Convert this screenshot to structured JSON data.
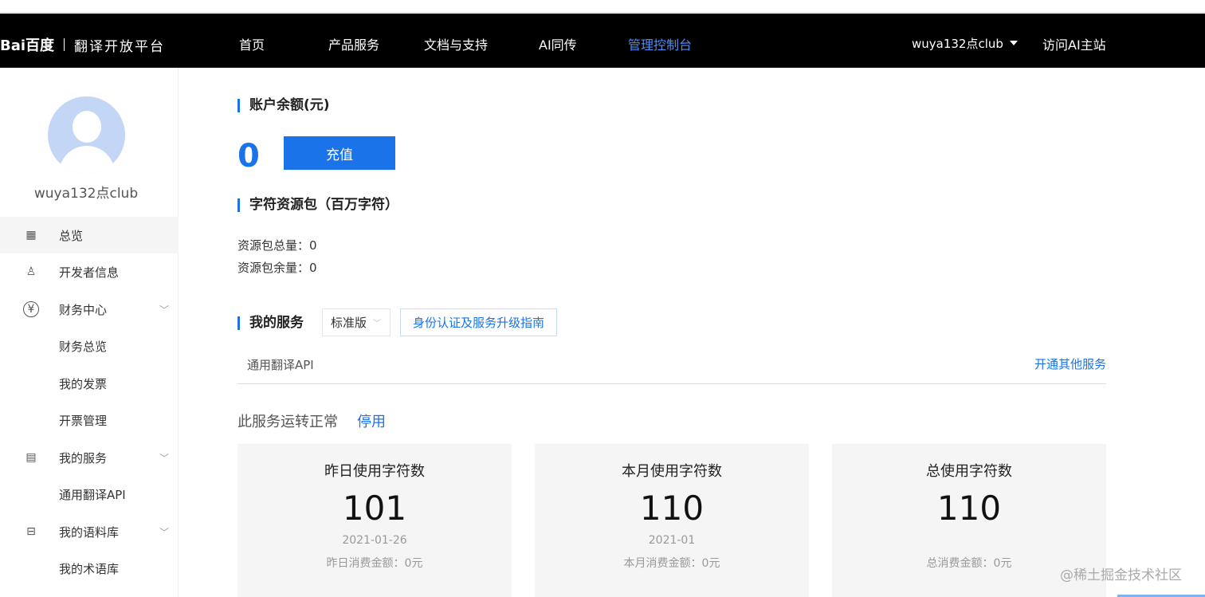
{
  "header": {
    "logo": "Bai百度",
    "subtitle": "翻译开放平台",
    "nav": [
      "首页",
      "产品服务",
      "文档与支持",
      "AI同传",
      "管理控制台"
    ],
    "user": "wuya132点club",
    "visit": "访问AI主站"
  },
  "sidebar": {
    "username": "wuya132点club",
    "items": [
      {
        "label": "总览",
        "icon": "grid-icon"
      },
      {
        "label": "开发者信息",
        "icon": "user-icon"
      },
      {
        "label": "财务中心",
        "icon": "yen-icon"
      },
      {
        "label": "财务总览"
      },
      {
        "label": "我的发票"
      },
      {
        "label": "开票管理"
      },
      {
        "label": "我的服务",
        "icon": "document-icon"
      },
      {
        "label": "通用翻译API"
      },
      {
        "label": "我的语料库",
        "icon": "inbox-icon"
      },
      {
        "label": "我的术语库"
      }
    ]
  },
  "main": {
    "balance_title": "账户余额(元)",
    "balance": "0",
    "recharge": "充值",
    "pack_title": "字符资源包（百万字符）",
    "pack_total": "资源包总量：0",
    "pack_left": "资源包余量：0",
    "services_title": "我的服务",
    "edition": "标准版",
    "guide": "身份认证及服务升级指南",
    "service_name": "通用翻译API",
    "open_other": "开通其他服务",
    "status": "此服务运转正常",
    "stop": "停用",
    "cards": [
      {
        "title": "昨日使用字符数",
        "value": "101",
        "date": "2021-01-26",
        "money": "昨日消费金额：0元"
      },
      {
        "title": "本月使用字符数",
        "value": "110",
        "date": "2021-01",
        "money": "本月消费金额：0元"
      },
      {
        "title": "总使用字符数",
        "value": "110",
        "date": "",
        "money": "总消费金额：0元"
      }
    ]
  },
  "watermark": "@稀土掘金技术社区"
}
